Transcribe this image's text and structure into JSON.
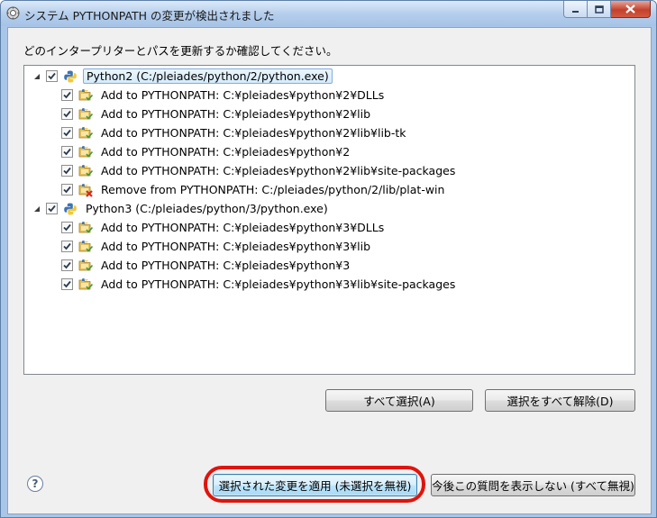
{
  "window": {
    "title": "システム PYTHONPATH の変更が検出されました"
  },
  "instruction": "どのインタープリターとパスを更新するか確認してください。",
  "tree": [
    {
      "label": "Python2  (C:/pleiades/python/2/python.exe)",
      "checked": true,
      "expanded": true,
      "selected": true,
      "children": [
        {
          "label": "Add to PYTHONPATH: C:¥pleiades¥python¥2¥DLLs",
          "action": "add",
          "checked": true
        },
        {
          "label": "Add to PYTHONPATH: C:¥pleiades¥python¥2¥lib",
          "action": "add",
          "checked": true
        },
        {
          "label": "Add to PYTHONPATH: C:¥pleiades¥python¥2¥lib¥lib-tk",
          "action": "add",
          "checked": true
        },
        {
          "label": "Add to PYTHONPATH: C:¥pleiades¥python¥2",
          "action": "add",
          "checked": true
        },
        {
          "label": "Add to PYTHONPATH: C:¥pleiades¥python¥2¥lib¥site-packages",
          "action": "add",
          "checked": true
        },
        {
          "label": "Remove from PYTHONPATH: C:/pleiades/python/2/lib/plat-win",
          "action": "remove",
          "checked": true
        }
      ]
    },
    {
      "label": "Python3  (C:/pleiades/python/3/python.exe)",
      "checked": true,
      "expanded": true,
      "selected": false,
      "children": [
        {
          "label": "Add to PYTHONPATH: C:¥pleiades¥python¥3¥DLLs",
          "action": "add",
          "checked": true
        },
        {
          "label": "Add to PYTHONPATH: C:¥pleiades¥python¥3¥lib",
          "action": "add",
          "checked": true
        },
        {
          "label": "Add to PYTHONPATH: C:¥pleiades¥python¥3",
          "action": "add",
          "checked": true
        },
        {
          "label": "Add to PYTHONPATH: C:¥pleiades¥python¥3¥lib¥site-packages",
          "action": "add",
          "checked": true
        }
      ]
    }
  ],
  "buttons": {
    "select_all": "すべて選択(A)",
    "deselect_all": "選択をすべて解除(D)",
    "apply_selected": "選択された変更を適用 (未選択を無視)",
    "dont_ask": "今後この質問を表示しない (すべて無視)"
  },
  "help_icon": "help-icon",
  "colors": {
    "highlight_ring": "#e0140c",
    "titlebar": "#b3cdec",
    "selection": "#d6ebfb"
  }
}
